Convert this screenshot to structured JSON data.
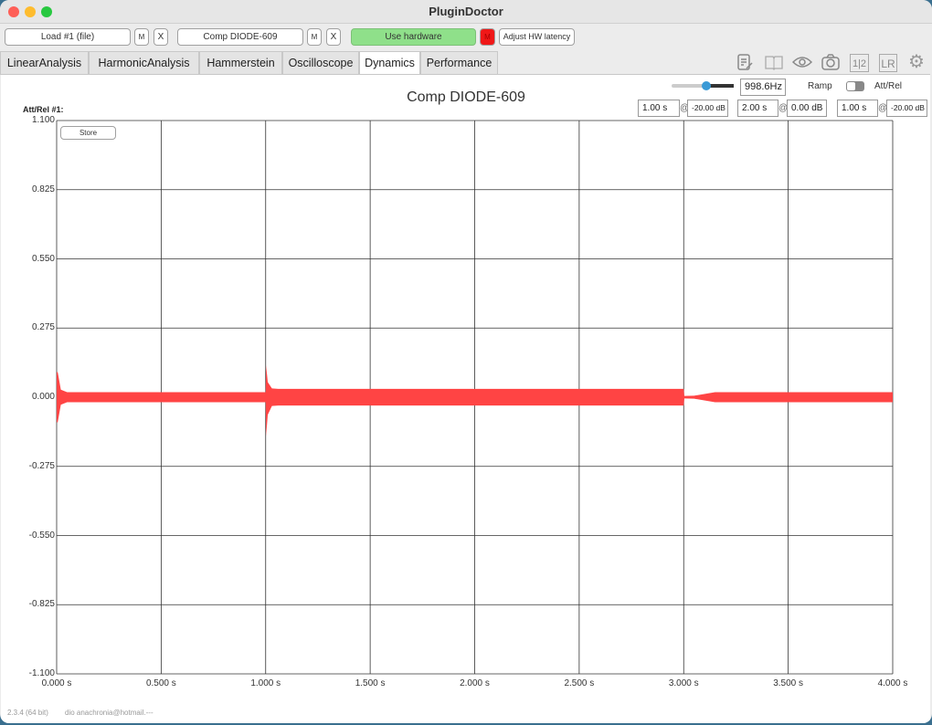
{
  "window": {
    "title": "PluginDoctor"
  },
  "toolbar": {
    "load_label": "Load #1 (file)",
    "m1": "M",
    "x1": "X",
    "plugin_label": "Comp DIODE-609",
    "m2": "M",
    "x2": "X",
    "use_hw": "Use hardware",
    "hw_m": "M",
    "adjust_latency": "Adjust HW latency"
  },
  "tabs": [
    {
      "label": "LinearAnalysis"
    },
    {
      "label": "HarmonicAnalysis"
    },
    {
      "label": "Hammerstein"
    },
    {
      "label": "Oscilloscope"
    },
    {
      "label": "Dynamics",
      "active": true
    },
    {
      "label": "Performance"
    }
  ],
  "icons": [
    "notes-icon",
    "book-icon",
    "eye-icon",
    "camera-icon",
    "channel-12-icon",
    "lr-icon",
    "gear-icon"
  ],
  "icon_text": {
    "ch12": "1|2",
    "lr": "LR"
  },
  "controls": {
    "slider_value": 0.6,
    "frequency": "998.6Hz",
    "ramp": "Ramp",
    "att_rel": "Att/Rel",
    "att_rel_label": "Att/Rel #1:",
    "segments": [
      {
        "time": "1.00 s",
        "level": "-20.00 dB"
      },
      {
        "time": "2.00 s",
        "level": "0.00 dB"
      },
      {
        "time": "1.00 s",
        "level": "-20.00 dB"
      }
    ],
    "at": "@"
  },
  "store": "Store",
  "footer": {
    "version": "2.3.4 (64 bit)",
    "user": "dio anachronia@hotmail.---"
  },
  "chart_data": {
    "type": "area",
    "title": "Comp DIODE-609",
    "color": "#ff4444",
    "xlabel": "",
    "ylabel": "",
    "xlim": [
      0,
      4
    ],
    "ylim": [
      -1.1,
      1.1
    ],
    "grid": true,
    "xticks": [
      "0.000 s",
      "0.500 s",
      "1.000 s",
      "1.500 s",
      "2.000 s",
      "2.500 s",
      "3.000 s",
      "3.500 s",
      "4.000 s"
    ],
    "yticks": [
      "1.100",
      "0.825",
      "0.550",
      "0.275",
      "0.000",
      "-0.275",
      "-0.550",
      "-0.825",
      "-1.100"
    ],
    "envelope": {
      "t": [
        0,
        0.005,
        0.02,
        0.05,
        1.0,
        1.002,
        1.01,
        1.03,
        1.06,
        3.0,
        3.003,
        3.05,
        3.15,
        3.2,
        4.0
      ],
      "upper": [
        0.1,
        0.1,
        0.03,
        0.02,
        0.02,
        0.127,
        0.06,
        0.035,
        0.033,
        0.033,
        0.005,
        0.006,
        0.02,
        0.02,
        0.02
      ],
      "lower": [
        -0.1,
        -0.1,
        -0.03,
        -0.02,
        -0.02,
        -0.155,
        -0.07,
        -0.035,
        -0.033,
        -0.033,
        -0.005,
        -0.006,
        -0.02,
        -0.02,
        -0.02
      ]
    }
  }
}
